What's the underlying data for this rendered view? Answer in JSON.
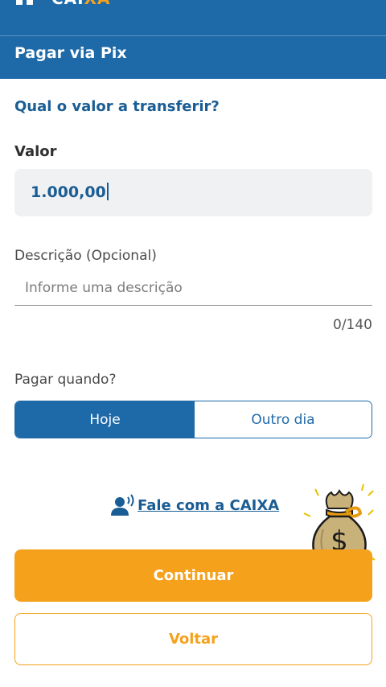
{
  "app": {
    "brand_prefix": "CAI",
    "brand_accent": "XA"
  },
  "header": {
    "title": "Pagar via Pix"
  },
  "form": {
    "question": "Qual o valor a transferir?",
    "valor_label": "Valor",
    "valor_value": "1.000,00",
    "descricao_label": "Descrição (Opcional)",
    "descricao_placeholder": "Informe uma descrição",
    "descricao_counter": "0/140",
    "quando_label": "Pagar quando?",
    "quando_options": [
      "Hoje",
      "Outro dia"
    ],
    "quando_selected": "Hoje"
  },
  "contact": {
    "link_label": "Fale com a CAIXA",
    "icon": "person-speaking-icon"
  },
  "actions": {
    "continue_label": "Continuar",
    "back_label": "Voltar"
  },
  "colors": {
    "primary_blue": "#1e6aa9",
    "accent_orange": "#f5a11c",
    "input_bg": "#f0f1f2"
  }
}
